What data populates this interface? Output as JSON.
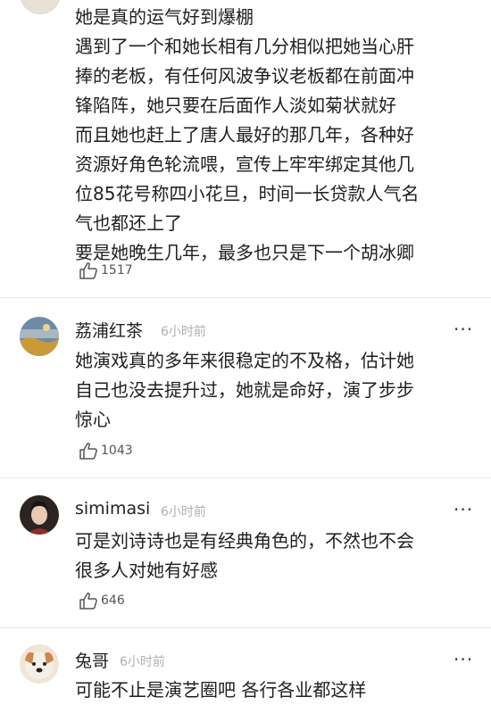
{
  "comments": [
    {
      "name": "",
      "time": "",
      "avatar_icon": "partial-avatar-icon",
      "lines": [
        "她是真的运气好到爆棚",
        "遇到了一个和她长相有几分相似把她当心肝",
        "捧的老板，有任何风波争议老板都在前面冲",
        "锋陷阵，她只要在后面作人淡如菊状就好",
        "而且她也赶上了唐人最好的那几年，各种好",
        "资源好角色轮流喂，宣传上牢牢绑定其他几",
        "位85花号称四小花旦，时间一长贷款人气名",
        "气也都还上了",
        "要是她晚生几年，最多也只是下一个胡冰卿"
      ],
      "likes": "1517"
    },
    {
      "name": "荔浦红茶",
      "time": "6小时前",
      "avatar_icon": "avatar-landscape-icon",
      "lines": [
        "她演戏真的多年来很稳定的不及格，估计她",
        "自己也没去提升过，她就是命好，演了步步",
        "惊心"
      ],
      "likes": "1043"
    },
    {
      "name": "simimasi",
      "time": "6小时前",
      "avatar_icon": "avatar-portrait-icon",
      "lines": [
        "可是刘诗诗也是有经典角色的，不然也不会",
        "很多人对她有好感"
      ],
      "likes": "646"
    },
    {
      "name": "兔哥",
      "time": "6小时前",
      "avatar_icon": "avatar-dog-icon",
      "lines": [
        "可能不止是演艺圈吧 各行各业都这样"
      ],
      "likes": ""
    }
  ],
  "more_icon": "more-dots-icon",
  "like_icon": "thumbs-up-icon",
  "colors": {
    "text": "#1f1f1f",
    "meta": "#b0b0b0",
    "divider": "#e9e9e9"
  }
}
